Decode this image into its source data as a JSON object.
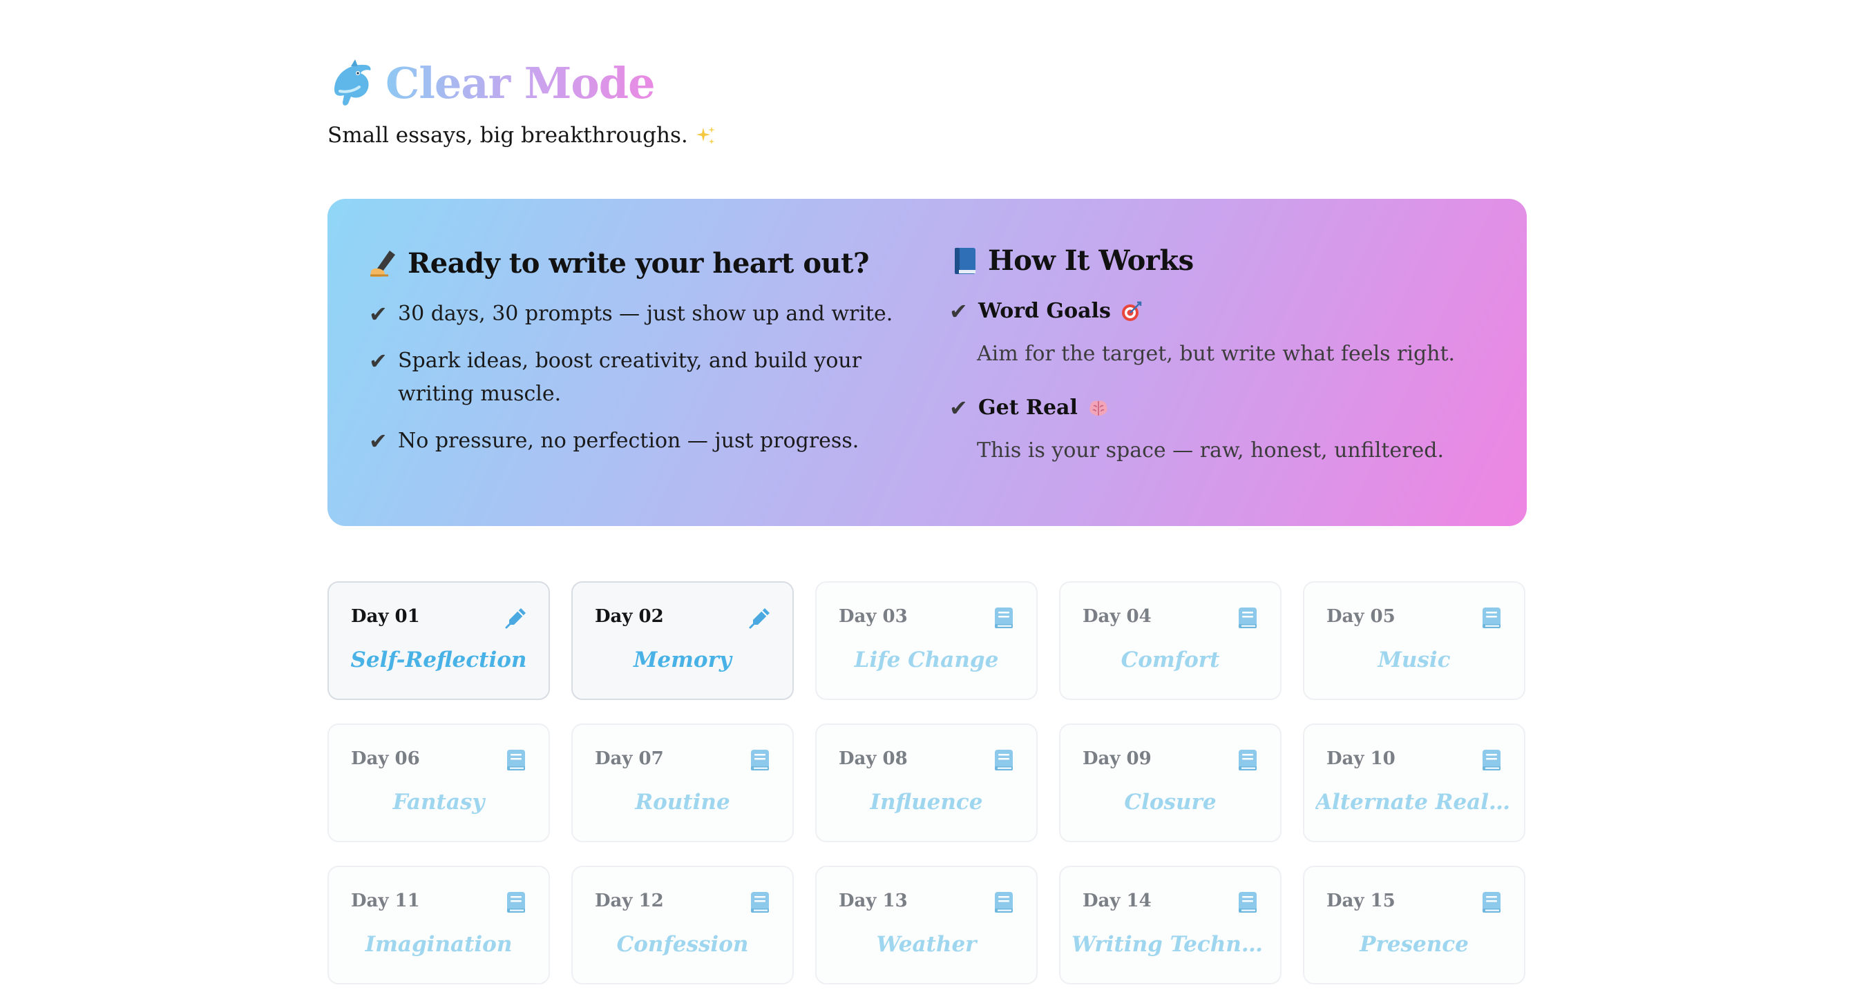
{
  "header": {
    "title": "Clear Mode",
    "logo_icon": "dolphin-icon",
    "subtitle": "Small essays, big breakthroughs.",
    "subtitle_icon": "sparkles-icon"
  },
  "intro": {
    "title": "Ready to write your heart out?",
    "title_icon": "writing-hand-icon",
    "items": [
      "30 days, 30 prompts — just show up and write.",
      "Spark ideas, boost creativity, and build your writing muscle.",
      "No pressure, no perfection — just progress."
    ]
  },
  "how": {
    "title": "How It Works",
    "title_icon": "blue-book-icon",
    "items": [
      {
        "title": "Word Goals",
        "icon": "target-icon",
        "desc": "Aim for the target, but write what feels right."
      },
      {
        "title": "Get Real",
        "icon": "brain-icon",
        "desc": "This is your space — raw, honest, unfiltered."
      }
    ]
  },
  "check_mark": "✔",
  "colors": {
    "accent_blue": "#48b2e6",
    "muted_blue": "#9ed6ef",
    "gradient_start": "#90d6f7",
    "gradient_end": "#ee85e3"
  },
  "days": [
    {
      "day": "Day 01",
      "topic": "Self-Reflection",
      "status": "done",
      "icon": "pen-icon"
    },
    {
      "day": "Day 02",
      "topic": "Memory",
      "status": "done",
      "icon": "pen-icon"
    },
    {
      "day": "Day 03",
      "topic": "Life Change",
      "status": "locked",
      "icon": "book-icon"
    },
    {
      "day": "Day 04",
      "topic": "Comfort",
      "status": "locked",
      "icon": "book-icon"
    },
    {
      "day": "Day 05",
      "topic": "Music",
      "status": "locked",
      "icon": "book-icon"
    },
    {
      "day": "Day 06",
      "topic": "Fantasy",
      "status": "locked",
      "icon": "book-icon"
    },
    {
      "day": "Day 07",
      "topic": "Routine",
      "status": "locked",
      "icon": "book-icon"
    },
    {
      "day": "Day 08",
      "topic": "Influence",
      "status": "locked",
      "icon": "book-icon"
    },
    {
      "day": "Day 09",
      "topic": "Closure",
      "status": "locked",
      "icon": "book-icon"
    },
    {
      "day": "Day 10",
      "topic": "Alternate Reality",
      "status": "locked",
      "icon": "book-icon"
    },
    {
      "day": "Day 11",
      "topic": "Imagination",
      "status": "locked",
      "icon": "book-icon"
    },
    {
      "day": "Day 12",
      "topic": "Confession",
      "status": "locked",
      "icon": "book-icon"
    },
    {
      "day": "Day 13",
      "topic": "Weather",
      "status": "locked",
      "icon": "book-icon"
    },
    {
      "day": "Day 14",
      "topic": "Writing Techniq...",
      "status": "locked",
      "icon": "book-icon"
    },
    {
      "day": "Day 15",
      "topic": "Presence",
      "status": "locked",
      "icon": "book-icon"
    }
  ]
}
